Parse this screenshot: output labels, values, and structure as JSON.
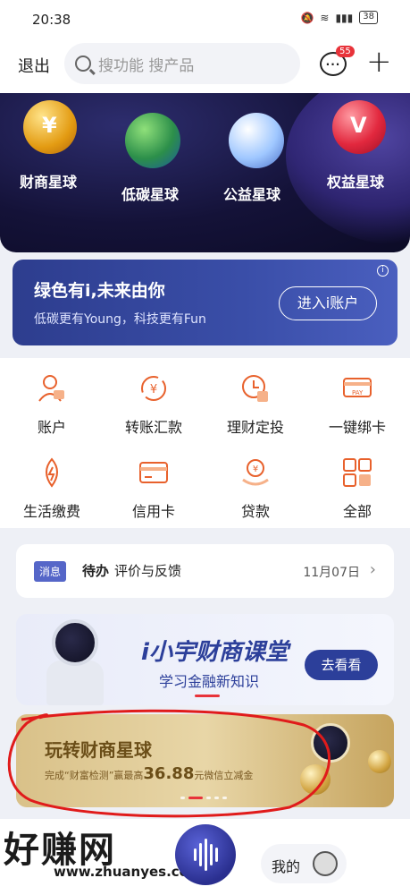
{
  "status": {
    "time": "20:38",
    "battery": "38"
  },
  "header": {
    "back_label": "退出",
    "search_placeholder": "搜功能 搜产品",
    "message_badge": "55"
  },
  "planets": [
    {
      "label": "财商星球",
      "glyph": "¥"
    },
    {
      "label": "低碳星球",
      "glyph": ""
    },
    {
      "label": "公益星球",
      "glyph": ""
    },
    {
      "label": "权益星球",
      "glyph": "V"
    }
  ],
  "promo": {
    "title": "绿色有i,未来由你",
    "subtitle": "低碳更有Young，科技更有Fun",
    "button": "进入i账户",
    "info": "i"
  },
  "grid": [
    {
      "label": "账户",
      "icon": "account-icon"
    },
    {
      "label": "转账汇款",
      "icon": "transfer-icon"
    },
    {
      "label": "理财定投",
      "icon": "investment-icon"
    },
    {
      "label": "一键绑卡",
      "icon": "bind-card-icon"
    },
    {
      "label": "生活缴费",
      "icon": "utility-icon"
    },
    {
      "label": "信用卡",
      "icon": "credit-card-icon"
    },
    {
      "label": "贷款",
      "icon": "loan-icon"
    },
    {
      "label": "全部",
      "icon": "all-icon"
    }
  ],
  "notice": {
    "tag": "消息",
    "bold": "待办",
    "text": "评价与反馈",
    "date": "11月07日"
  },
  "course": {
    "title": "i小宇财商课堂",
    "subtitle": "学习金融新知识",
    "button": "去看看"
  },
  "gold_banner": {
    "title": "玩转财商星球",
    "prefix": "完成“财富检测”赢最高",
    "amount": "36.88",
    "suffix": "元微信立减金"
  },
  "bottom": {
    "watermark": "好赚网",
    "watermark_url": "www.zhuanyes.com",
    "mine": "我的"
  },
  "colors": {
    "accent": "#e8612c",
    "brand_blue": "#2c3f9a",
    "annotation_red": "#e01b1b"
  }
}
